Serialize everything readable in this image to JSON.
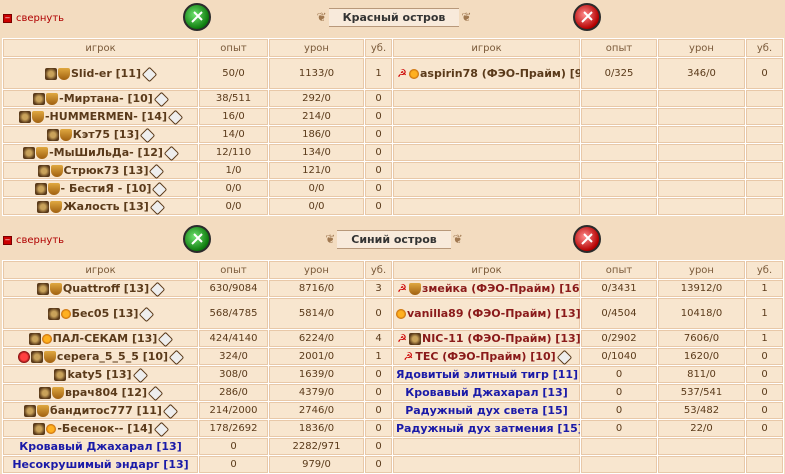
{
  "collapse_label": "свернуть",
  "columns": {
    "player": "игрок",
    "exp": "опыт",
    "damage": "урон",
    "kills": "уб."
  },
  "red_island": {
    "title": "Красный остров",
    "left": [
      {
        "name": "Slid-er [11]",
        "exp": "50/0",
        "damage": "1133/0",
        "kills": "1"
      },
      {
        "name": "-Миртана- [10]",
        "exp": "38/511",
        "damage": "292/0",
        "kills": "0"
      },
      {
        "name": "-HUMMERMEN- [14]",
        "exp": "16/0",
        "damage": "214/0",
        "kills": "0"
      },
      {
        "name": "Кэт75 [13]",
        "exp": "14/0",
        "damage": "186/0",
        "kills": "0"
      },
      {
        "name": "-МыШиЛьДа- [12]",
        "exp": "12/110",
        "damage": "134/0",
        "kills": "0"
      },
      {
        "name": "Стрюк73 [13]",
        "exp": "1/0",
        "damage": "121/0",
        "kills": "0"
      },
      {
        "name": "- БестиЯ - [10]",
        "exp": "0/0",
        "damage": "0/0",
        "kills": "0"
      },
      {
        "name": "Жалость [13]",
        "exp": "0/0",
        "damage": "0/0",
        "kills": "0"
      }
    ],
    "right": [
      {
        "name": "aspirin78 (ФЭО-Прайм) [9]",
        "exp": "0/325",
        "damage": "346/0",
        "kills": "0"
      }
    ]
  },
  "blue_island": {
    "title": "Синий остров",
    "left": [
      {
        "name": "Quattroff [13]",
        "exp": "630/9084",
        "damage": "8716/0",
        "kills": "3"
      },
      {
        "name": "Бес05 [13]",
        "exp": "568/4785",
        "damage": "5814/0",
        "kills": "0"
      },
      {
        "name": "ПАЛ-СЕКАМ [13]",
        "exp": "424/4140",
        "damage": "6224/0",
        "kills": "4"
      },
      {
        "name": "серега_5_5_5 [10]",
        "exp": "324/0",
        "damage": "2001/0",
        "kills": "1"
      },
      {
        "name": "katy5 [13]",
        "exp": "308/0",
        "damage": "1639/0",
        "kills": "0"
      },
      {
        "name": "врач804 [12]",
        "exp": "286/0",
        "damage": "4379/0",
        "kills": "0"
      },
      {
        "name": "бандитос777 [11]",
        "exp": "214/2000",
        "damage": "2746/0",
        "kills": "0"
      },
      {
        "name": "-Бесенок-- [14]",
        "exp": "178/2692",
        "damage": "1836/0",
        "kills": "0"
      },
      {
        "name": "Кровавый Джахарал [13]",
        "exp": "0",
        "damage": "2282/971",
        "kills": "0"
      },
      {
        "name": "Несокрушимый эндарг [13]",
        "exp": "0",
        "damage": "979/0",
        "kills": "0"
      }
    ],
    "right": [
      {
        "name": "змейка (ФЭО-Прайм) [16]",
        "exp": "0/3431",
        "damage": "13912/0",
        "kills": "1"
      },
      {
        "name": "vanilla89 (ФЭО-Прайм) [13]",
        "exp": "0/4504",
        "damage": "10418/0",
        "kills": "1"
      },
      {
        "name": "NIC-11 (ФЭО-Прайм) [13]",
        "exp": "0/2902",
        "damage": "7606/0",
        "kills": "1"
      },
      {
        "name": "TEC (ФЭО-Прайм) [10]",
        "exp": "0/1040",
        "damage": "1620/0",
        "kills": "0"
      },
      {
        "name": "Ядовитый элитный тигр [11]",
        "exp": "0",
        "damage": "811/0",
        "kills": "0"
      },
      {
        "name": "Кровавый Джахарал [13]",
        "exp": "0",
        "damage": "537/541",
        "kills": "0"
      },
      {
        "name": "Радужный дух света  [15]",
        "exp": "0",
        "damage": "53/482",
        "kills": "0"
      },
      {
        "name": "Радужный дух затмения  [15]",
        "exp": "0",
        "damage": "22/0",
        "kills": "0"
      }
    ]
  }
}
